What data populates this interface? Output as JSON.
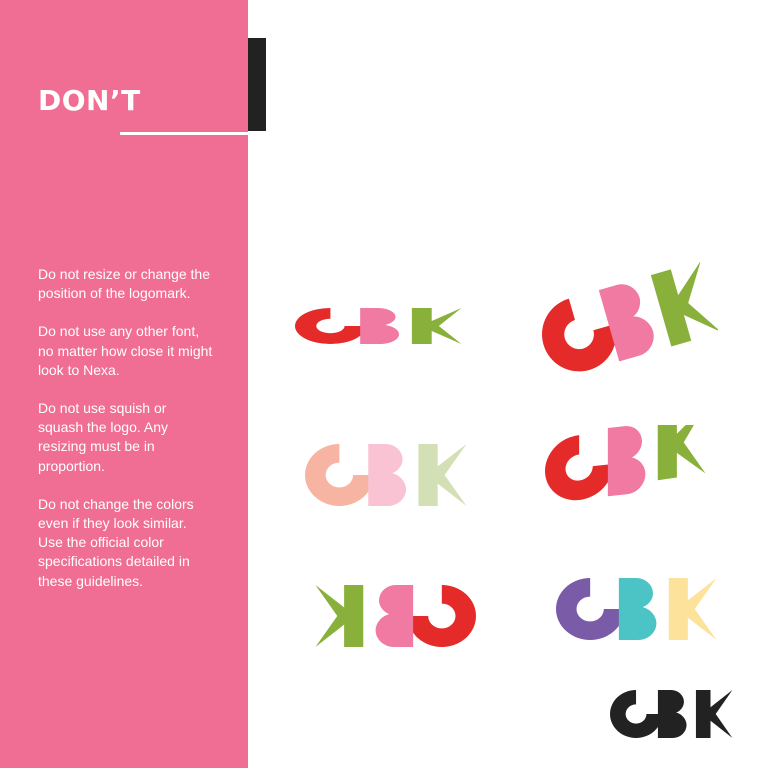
{
  "heading": "DON’T",
  "rules": [
    "Do not resize or change the position of the logomark.",
    "Do not use any other font, no matter how close it might look to Nexa.",
    "Do not use squish or squash the logo. Any resizing must be in proportion.",
    "Do not change the colors even if they look similar. Use the official color specifications detailed in these guidelines."
  ],
  "colors": {
    "panel": "#f06d93",
    "official": {
      "c": "#e52a2a",
      "b": "#f07aa2",
      "k": "#8ab03c"
    },
    "pastel": {
      "c": "#f7b4a2",
      "b": "#f9c3d3",
      "k": "#d3e0b6"
    },
    "alt": {
      "c": "#7a5ba8",
      "b": "#4cc3c5",
      "k": "#fde29b"
    },
    "mono": "#222222"
  },
  "examples": [
    {
      "name": "logo-squashed",
      "variant": "official"
    },
    {
      "name": "logo-rotated",
      "variant": "official"
    },
    {
      "name": "logo-pastel-colors",
      "variant": "pastel"
    },
    {
      "name": "logo-wavy-distorted",
      "variant": "official"
    },
    {
      "name": "logo-mirrored",
      "variant": "official"
    },
    {
      "name": "logo-alternate-colors",
      "variant": "alt"
    },
    {
      "name": "logo-correct-mono",
      "variant": "mono"
    }
  ]
}
